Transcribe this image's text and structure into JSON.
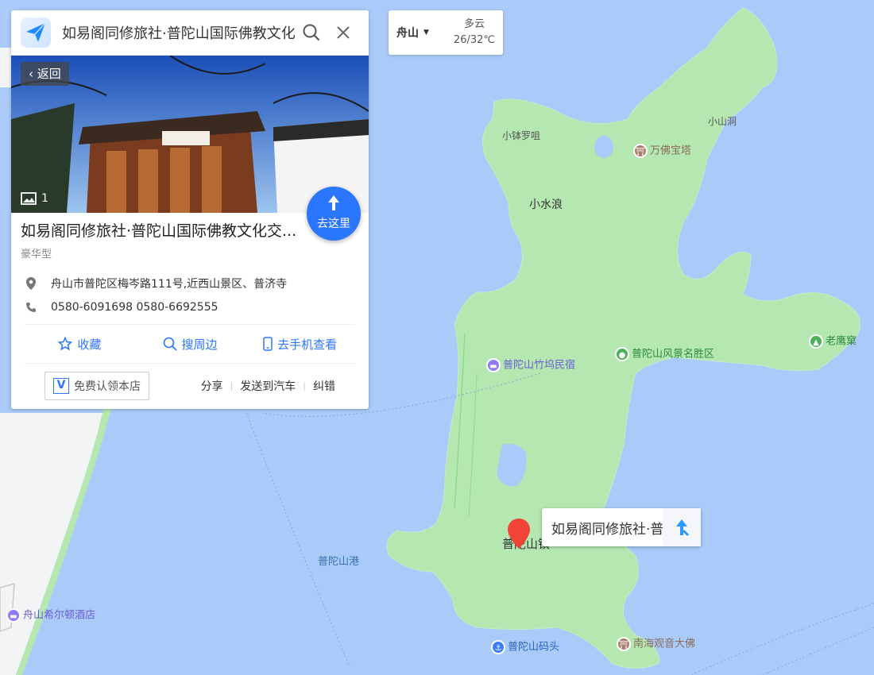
{
  "search": {
    "query": "如易阁同修旅社·普陀山国际佛教文化交流中心"
  },
  "place": {
    "back_label": "返回",
    "photo_count": "1",
    "goto_label": "去这里",
    "title": "如易阁同修旅社·普陀山国际佛教文化交...",
    "type": "豪华型",
    "address": "舟山市普陀区梅岑路111号,近西山景区、普济寺",
    "phone": "0580-6091698 0580-6692555",
    "actions": [
      "收藏",
      "搜周边",
      "去手机查看"
    ],
    "claim_label": "免费认领本店",
    "links": [
      "分享",
      "发送到汽车",
      "纠错"
    ]
  },
  "weather": {
    "city": "舟山",
    "condition": "多云",
    "temp": "26/32℃"
  },
  "tooltip": {
    "text": "如易阁同修旅社·普陀山国际佛教文化交流中心"
  },
  "map_labels": {
    "xiaoboluoming": "小钵罗咀",
    "xiaoshandong": "小山洞",
    "wanfo": "万佛宝塔",
    "xiaoshuilang": "小水浪",
    "laoyingke": "老鹰窠",
    "zhuwu": "普陀山竹坞民宿",
    "fengjing": "普陀山风景名胜区",
    "putuoshan_zhen": "普陀山镇",
    "gang": "普陀山港",
    "matou": "普陀山码头",
    "nanhai": "南海观音大佛",
    "hilton": "舟山希尔顿酒店"
  },
  "colors": {
    "water": "#aacbf9",
    "land": "#b5e8b1",
    "accent": "#2b76ff",
    "marker": "#f04438",
    "hotel": "#8e7cf6",
    "scenic": "#4bb25a",
    "temple": "#a7806d",
    "port": "#3a7bff"
  }
}
